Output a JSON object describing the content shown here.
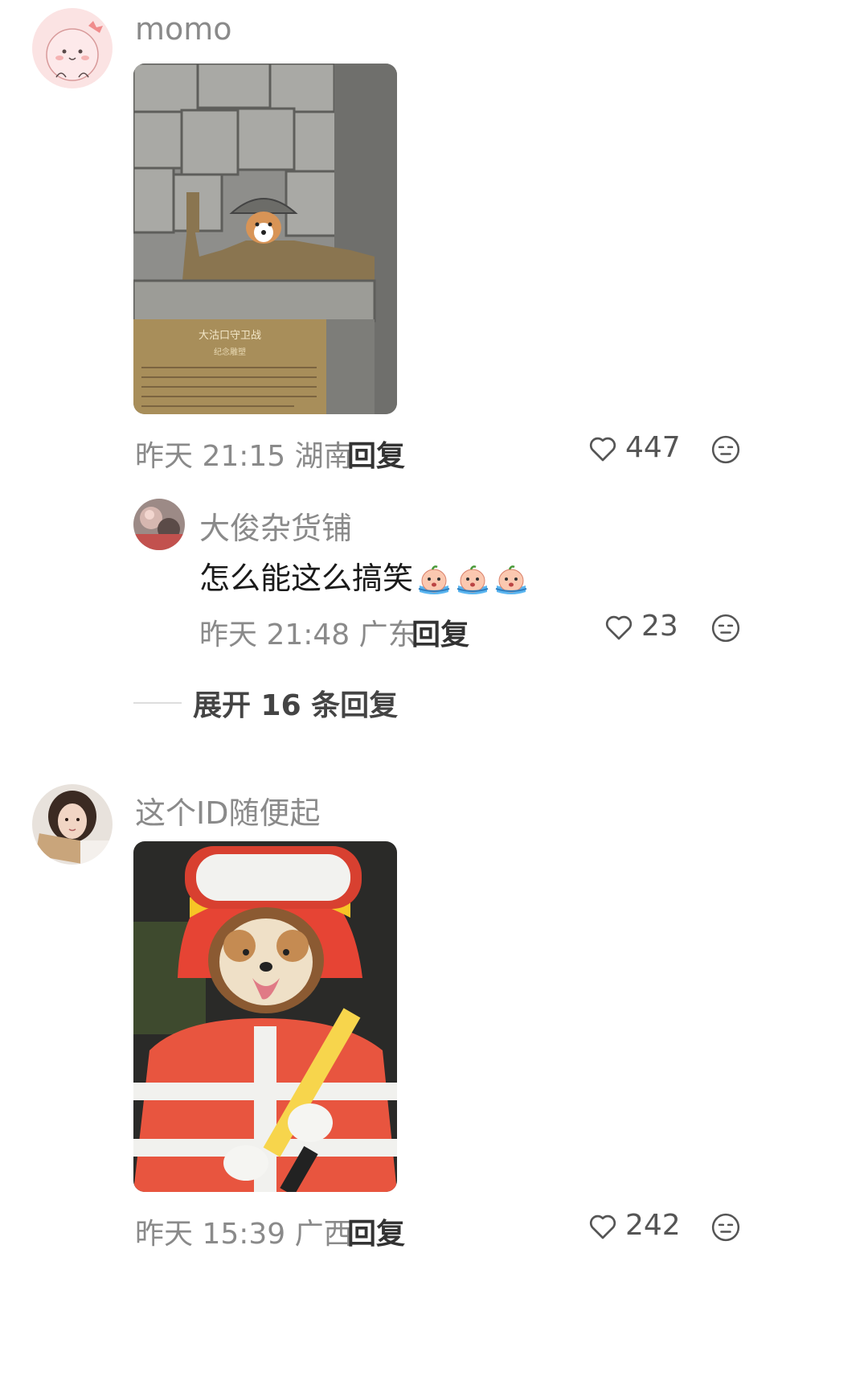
{
  "comments": [
    {
      "username": "momo",
      "meta_text": "昨天 21:15 湖南",
      "reply_label": "回复",
      "likes": "447",
      "photo_text": [
        "大沽口守卫战",
        "纪念雕塑"
      ],
      "replies": [
        {
          "username": "大俊杂货铺",
          "text": "怎么能这么搞笑",
          "emoji_count": 3,
          "meta_text": "昨天 21:48 广东",
          "reply_label": "回复",
          "likes": "23"
        }
      ],
      "expand_label": "展开 16 条回复"
    },
    {
      "username": "这个ID随便起",
      "meta_text": "昨天 15:39 广西",
      "reply_label": "回复",
      "likes": "242"
    }
  ],
  "icons": {
    "like": "heart-outline-icon",
    "dislike": "unamused-face-icon",
    "emoji": "crying-peach-emoji"
  },
  "colors": {
    "secondary_text": "#8a8a8a",
    "primary_text": "#1a1a1a"
  }
}
